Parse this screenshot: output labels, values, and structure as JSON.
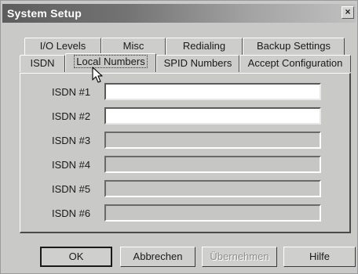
{
  "window": {
    "title": "System Setup",
    "close_label": "×"
  },
  "tabs_back_row": [
    {
      "label": "I/O Levels"
    },
    {
      "label": "Misc"
    },
    {
      "label": "Redialing"
    },
    {
      "label": "Backup Settings"
    }
  ],
  "tabs_front_row": [
    {
      "label": "ISDN"
    },
    {
      "label": "Local Numbers",
      "active": true
    },
    {
      "label": "SPID Numbers"
    },
    {
      "label": "Accept Configuration"
    }
  ],
  "fields": [
    {
      "label": "ISDN #1",
      "value": "",
      "enabled": true
    },
    {
      "label": "ISDN #2",
      "value": "",
      "enabled": true
    },
    {
      "label": "ISDN #3",
      "value": "",
      "enabled": false
    },
    {
      "label": "ISDN #4",
      "value": "",
      "enabled": false
    },
    {
      "label": "ISDN #5",
      "value": "",
      "enabled": false
    },
    {
      "label": "ISDN #6",
      "value": "",
      "enabled": false
    }
  ],
  "buttons": {
    "ok": "OK",
    "cancel": "Abbrechen",
    "apply": "Übernehmen",
    "help": "Hilfe"
  }
}
